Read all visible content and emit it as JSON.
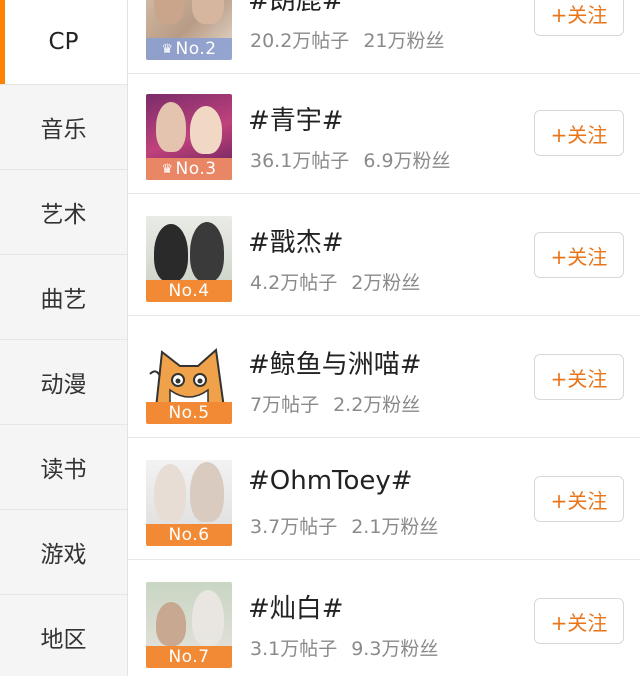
{
  "sidebar": {
    "items": [
      {
        "label": "CP",
        "active": true
      },
      {
        "label": "音乐"
      },
      {
        "label": "艺术"
      },
      {
        "label": "曲艺"
      },
      {
        "label": "动漫"
      },
      {
        "label": "读书"
      },
      {
        "label": "游戏"
      },
      {
        "label": "地区"
      }
    ]
  },
  "list": {
    "follow_label": "+关注",
    "items": [
      {
        "rank": "No.2",
        "name": "#朗鹿#",
        "posts": "20.2万帖子",
        "fans": "21万粉丝"
      },
      {
        "rank": "No.3",
        "name": "#青宇#",
        "posts": "36.1万帖子",
        "fans": "6.9万粉丝"
      },
      {
        "rank": "No.4",
        "name": "#戬杰#",
        "posts": "4.2万帖子",
        "fans": "2万粉丝"
      },
      {
        "rank": "No.5",
        "name": "#鲸鱼与洲喵#",
        "posts": "7万帖子",
        "fans": "2.2万粉丝"
      },
      {
        "rank": "No.6",
        "name": "#OhmToey#",
        "posts": "3.7万帖子",
        "fans": "2.1万粉丝"
      },
      {
        "rank": "No.7",
        "name": "#灿白#",
        "posts": "3.1万帖子",
        "fans": "9.3万粉丝"
      }
    ]
  },
  "colors": {
    "accent": "#ff8200",
    "follow_text": "#e8751a",
    "rank_badge": "#f28a35"
  }
}
